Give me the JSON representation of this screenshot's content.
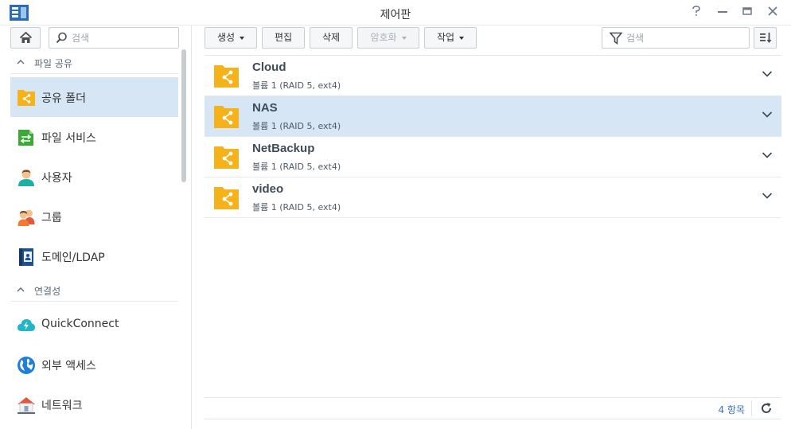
{
  "window": {
    "title": "제어판",
    "controls": [
      "help-icon",
      "minimize-icon",
      "maximize-icon",
      "close-icon"
    ]
  },
  "sidebar": {
    "search_placeholder": "검색",
    "sections": [
      {
        "label": "파일 공유",
        "items": [
          {
            "label": "공유 폴더",
            "icon": "shared-folder-icon",
            "selected": true
          },
          {
            "label": "파일 서비스",
            "icon": "file-services-icon"
          },
          {
            "label": "사용자",
            "icon": "user-icon"
          },
          {
            "label": "그룹",
            "icon": "group-icon"
          },
          {
            "label": "도메인/LDAP",
            "icon": "domain-ldap-icon"
          }
        ]
      },
      {
        "label": "연결성",
        "items": [
          {
            "label": "QuickConnect",
            "icon": "quickconnect-icon"
          },
          {
            "label": "외부 액세스",
            "icon": "external-access-icon"
          },
          {
            "label": "네트워크",
            "icon": "network-icon"
          }
        ]
      }
    ]
  },
  "toolbar": {
    "create_label": "생성",
    "edit_label": "편집",
    "delete_label": "삭제",
    "encryption_label": "암호화",
    "action_label": "작업",
    "filter_placeholder": "검색"
  },
  "folders": [
    {
      "name": "Cloud",
      "desc": "볼륨 1 (RAID 5, ext4)"
    },
    {
      "name": "NAS",
      "desc": "볼륨 1 (RAID 5, ext4)",
      "selected": true
    },
    {
      "name": "NetBackup",
      "desc": "볼륨 1 (RAID 5, ext4)"
    },
    {
      "name": "video",
      "desc": "볼륨 1 (RAID 5, ext4)"
    }
  ],
  "footer": {
    "item_count": "4 항목"
  },
  "colors": {
    "accent": "#3b73b9",
    "selection": "#d6e6f5",
    "folder": "#f5b21a"
  }
}
